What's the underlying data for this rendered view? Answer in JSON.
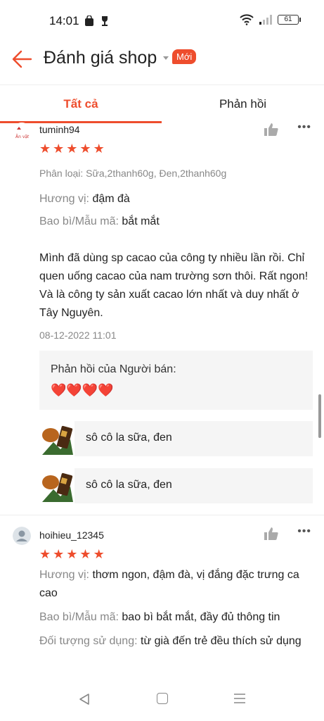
{
  "status": {
    "time": "14:01",
    "battery": "61"
  },
  "header": {
    "title": "Đánh giá shop",
    "badge": "Mới"
  },
  "tabs": [
    {
      "label": "Tất cả"
    },
    {
      "label": "Phản hồi"
    }
  ],
  "reviews": [
    {
      "username": "tuminh94",
      "stars": 5,
      "variant": "Phân loại: Sữa,2thanh60g, Đen,2thanh60g",
      "attributes": [
        {
          "key": "Hương vị:",
          "value": "đậm đà"
        },
        {
          "key": "Bao bì/Mẫu mã:",
          "value": "bắt mắt"
        }
      ],
      "comment": "Mình đã dùng sp cacao của công ty nhiều lần rồi. Chỉ quen uống cacao của nam trường sơn thôi. Rất ngon! Và là công ty sản xuất cacao lớn nhất và duy nhất ở Tây Nguyên.",
      "date": "08-12-2022 11:01",
      "seller_reply": {
        "title": "Phản hồi của Người bán:",
        "text": "❤️❤️❤️❤️"
      },
      "products": [
        {
          "name": "sô cô la sữa, đen"
        },
        {
          "name": "sô cô la sữa, đen"
        }
      ]
    },
    {
      "username": "hoihieu_12345",
      "stars": 5,
      "attributes": [
        {
          "key": "Hương vị:",
          "value": "thơm ngon, đậm đà, vị đắng đặc trưng ca cao"
        },
        {
          "key": "Bao bì/Mẫu mã:",
          "value": "bao bì bắt mắt, đầy đủ thông tin"
        },
        {
          "key": "Đối tượng sử dụng:",
          "value": "từ già đến trẻ đều thích sử dụng"
        }
      ]
    }
  ],
  "colors": {
    "accent": "#ee4d2d",
    "muted": "#888888",
    "panel": "#f5f5f5"
  }
}
